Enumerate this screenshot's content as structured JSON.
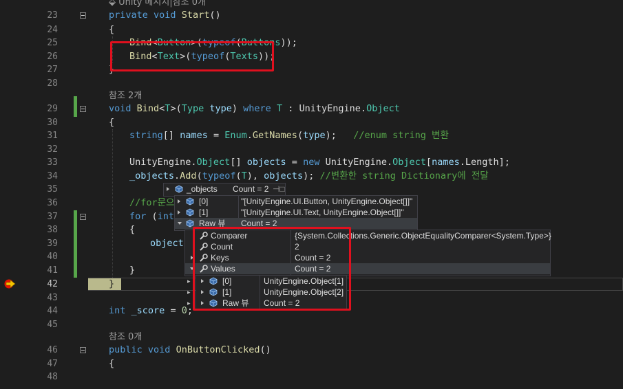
{
  "editor": {
    "lines": [
      {
        "num": "23",
        "meta": "Unity 메시지|참조 0개"
      },
      {
        "num": "24"
      },
      {
        "num": "25"
      },
      {
        "num": "26"
      },
      {
        "num": "27"
      },
      {
        "num": "28"
      },
      {
        "num": "29",
        "meta": "참조 2개"
      },
      {
        "num": "30"
      },
      {
        "num": "31"
      },
      {
        "num": "32"
      },
      {
        "num": "33"
      },
      {
        "num": "34"
      },
      {
        "num": "35"
      },
      {
        "num": "36"
      },
      {
        "num": "37"
      },
      {
        "num": "38"
      },
      {
        "num": "39"
      },
      {
        "num": "40"
      },
      {
        "num": "41"
      },
      {
        "num": "42"
      },
      {
        "num": "43"
      },
      {
        "num": "44"
      },
      {
        "num": "45"
      },
      {
        "num": "46",
        "meta": "참조 0개"
      },
      {
        "num": "47"
      },
      {
        "num": "48"
      }
    ],
    "code": {
      "l23_k1": "private",
      "l23_k2": "void",
      "l23_m": "Start",
      "l23_p": "()",
      "l24": "{",
      "l25_m": "Bind",
      "l25_lt": "<",
      "l25_t": "Button",
      "l25_gt": ">(",
      "l25_k": "typeof",
      "l25_p1": "(",
      "l25_t2": "Buttons",
      "l25_p2": "));",
      "l26_m": "Bind",
      "l26_lt": "<",
      "l26_t": "Text",
      "l26_gt": ">(",
      "l26_k": "typeof",
      "l26_p1": "(",
      "l26_t2": "Texts",
      "l26_p2": "));",
      "l27": "}",
      "l29_k": "void",
      "l29_m": "Bind",
      "l29_a": "<",
      "l29_t": "T",
      "l29_b": ">(",
      "l29_t2": "Type",
      "l29_v": "type",
      "l29_c": ")",
      "l29_k2": "where",
      "l29_t3": "T",
      "l29_d": ":",
      "l29_e": "UnityEngine.",
      "l29_t4": "Object",
      "l30": "{",
      "l31_k": "string",
      "l31_a": "[]",
      "l31_v": "names",
      "l31_b": "=",
      "l31_t": "Enum",
      "l31_c": ".",
      "l31_m": "GetNames",
      "l31_d": "(",
      "l31_v2": "type",
      "l31_e": ");",
      "l31_cm": "//enum string 변환",
      "l33_a": "UnityEngine.",
      "l33_t": "Object",
      "l33_b": "[]",
      "l33_v": "objects",
      "l33_c": "=",
      "l33_k": "new",
      "l33_d": "UnityEngine.",
      "l33_t2": "Object",
      "l33_e": "[",
      "l33_v2": "names",
      "l33_f": ".Length];",
      "l34_v": "_objects",
      "l34_a": ".",
      "l34_m": "Add",
      "l34_b": "(",
      "l34_k": "typeof",
      "l34_c": "(",
      "l34_t": "T",
      "l34_d": "),",
      "l34_v2": "objects",
      "l34_e": ");",
      "l34_cm": "//변환한 string Dictionary에 전달",
      "l36_cm": "//for문으",
      "l37_k": "for",
      "l37_a": "(",
      "l37_k2": "int",
      "l38": "{",
      "l39_v": "objects",
      "l41": "}",
      "l42": "}",
      "l44_k": "int",
      "l44_v": "_score",
      "l44_a": "=",
      "l44_n": "0",
      "l44_b": ";",
      "l46_k1": "public",
      "l46_k2": "void",
      "l46_m": "OnButtonClicked",
      "l46_p": "()",
      "l47": "{"
    }
  },
  "datatip": {
    "header_name": "_objects",
    "header_value": "Count = 2",
    "rows": [
      {
        "name": "[0]",
        "value": "\"[UnityEngine.UI.Button, UnityEngine.Object[]]\""
      },
      {
        "name": "[1]",
        "value": "\"[UnityEngine.UI.Text, UnityEngine.Object[]]\""
      },
      {
        "name": "Raw 뷰",
        "value": "Count = 2"
      }
    ]
  },
  "rawview": {
    "rows": [
      {
        "name": "Comparer",
        "value": "{System.Collections.Generic.ObjectEqualityComparer<System.Type>}"
      },
      {
        "name": "Count",
        "value": "2"
      },
      {
        "name": "Keys",
        "value": "Count = 2"
      },
      {
        "name": "Values",
        "value": "Count = 2"
      }
    ]
  },
  "values_tip": {
    "rows": [
      {
        "name": "[0]",
        "value": "UnityEngine.Object[1]"
      },
      {
        "name": "[1]",
        "value": "UnityEngine.Object[2]"
      },
      {
        "name": "Raw 뷰",
        "value": "Count = 2"
      }
    ]
  },
  "colors": {
    "keyword": "#569cd6",
    "type": "#4ec9b0",
    "method": "#dcdcaa",
    "variable": "#9cdcfe",
    "comment": "#57a64a",
    "highlight": "#e0101e"
  }
}
